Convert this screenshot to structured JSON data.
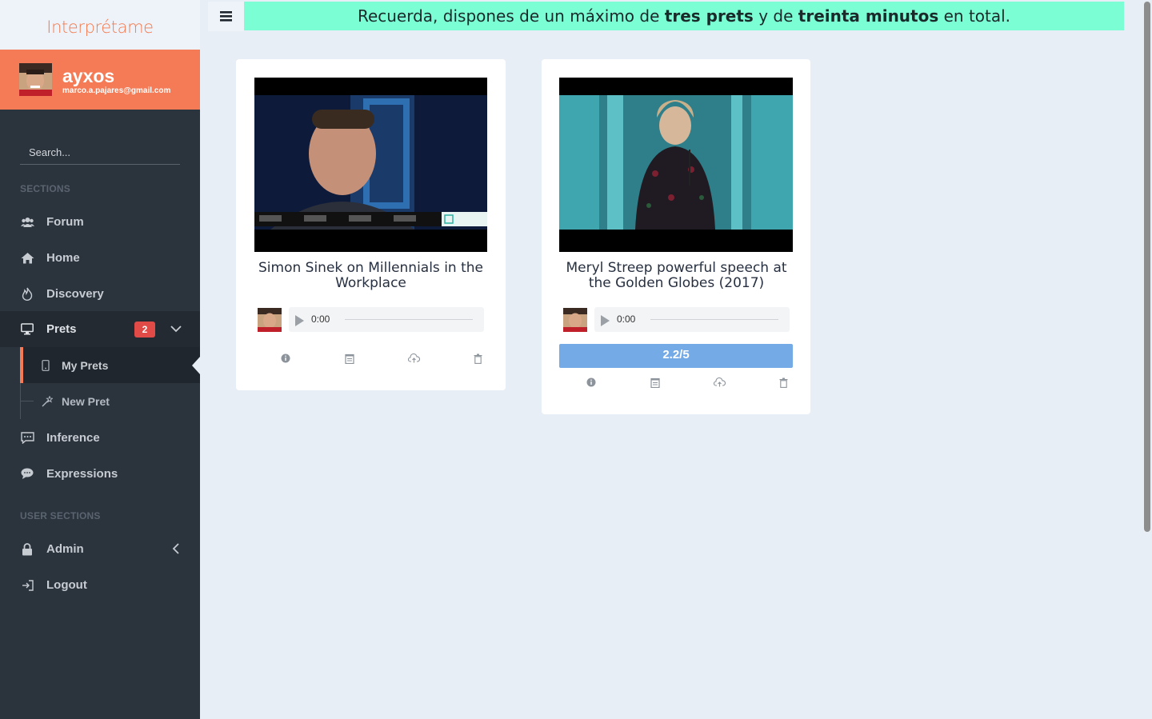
{
  "logo": {
    "text": "Interprétame"
  },
  "profile": {
    "name": "ayxos",
    "email": "marco.a.pajares@gmail.com"
  },
  "search": {
    "placeholder": "Search..."
  },
  "sections_title": "SECTIONS",
  "nav": [
    {
      "label": "Forum",
      "icon": "users-icon"
    },
    {
      "label": "Home",
      "icon": "home-icon"
    },
    {
      "label": "Discovery",
      "icon": "flame-icon"
    },
    {
      "label": "Prets",
      "icon": "monitor-icon",
      "badge": "2",
      "expanded": true
    },
    {
      "label": "Inference",
      "icon": "comment-icon"
    },
    {
      "label": "Expressions",
      "icon": "chat-bubbles-icon"
    }
  ],
  "prets_sub": [
    {
      "label": "My Prets",
      "icon": "mobile-icon",
      "active": true
    },
    {
      "label": "New Pret",
      "icon": "wand-icon"
    }
  ],
  "user_sections_title": "USER SECTIONS",
  "user_nav": [
    {
      "label": "Admin",
      "icon": "lock-icon"
    },
    {
      "label": "Logout",
      "icon": "logout-icon"
    }
  ],
  "banner": {
    "part1": "Recuerda, dispones de un máximo de ",
    "bold1": "tres prets",
    "part2": " y de ",
    "bold2": "treinta minutos",
    "part3": " en total."
  },
  "cards": [
    {
      "title": "Simon Sinek on Millennials in the Workplace",
      "time": "0:00",
      "rating": null
    },
    {
      "title": "Meryl Streep powerful speech at the Golden Globes (2017)",
      "time": "0:00",
      "rating": "2.2/5"
    }
  ],
  "colors": {
    "accent": "#f47b55",
    "sidebar": "#2b333d",
    "banner": "#7cfed5",
    "rating": "#74aae6",
    "badge": "#e04a47"
  }
}
